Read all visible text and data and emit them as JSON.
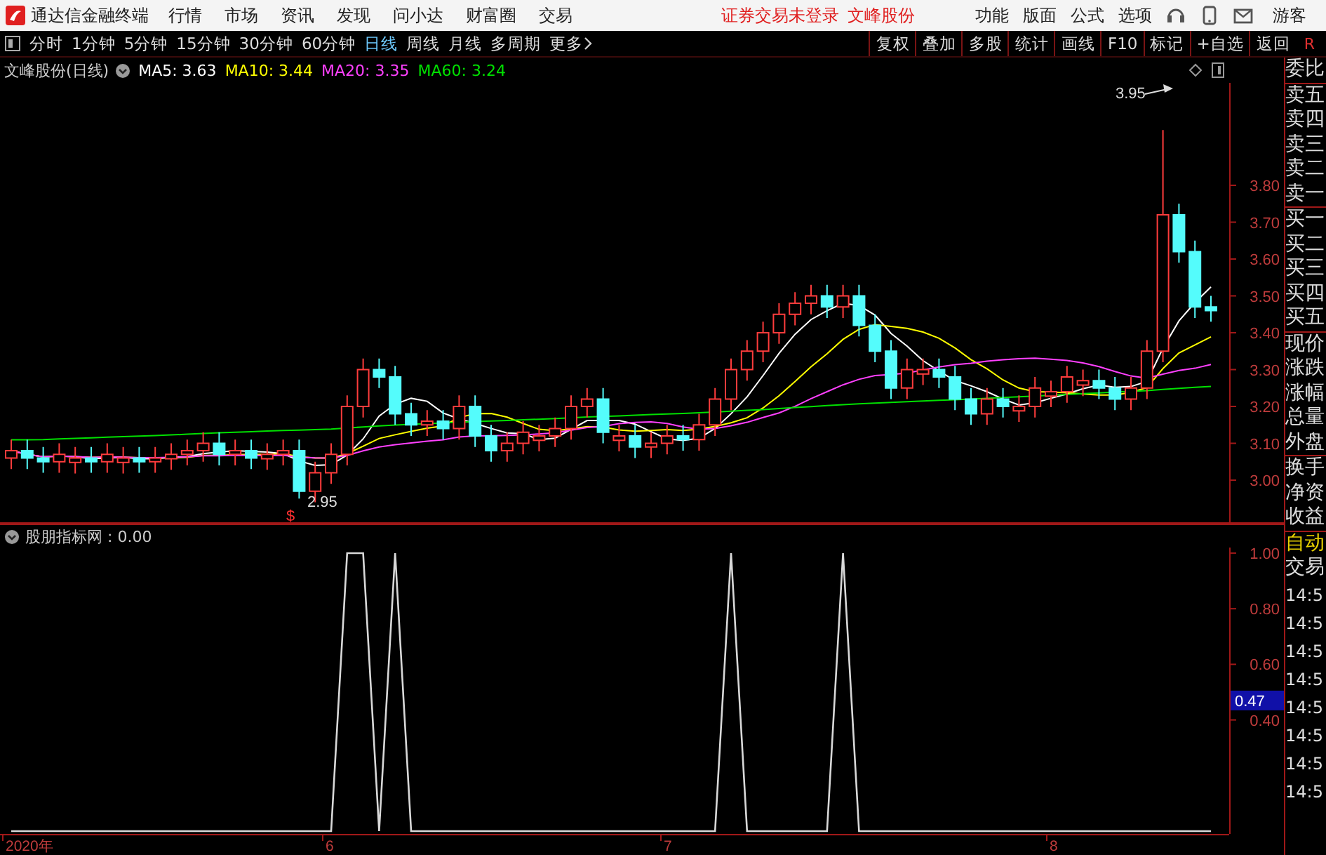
{
  "title_bar": {
    "app_name": "通达信金融终端",
    "menus": [
      "行情",
      "市场",
      "资讯",
      "发现",
      "问小达",
      "财富圈",
      "交易"
    ],
    "login_status": "证券交易未登录",
    "stock_name": "文峰股份",
    "right_menus": [
      "功能",
      "版面",
      "公式",
      "选项"
    ],
    "user": "游客"
  },
  "toolbar": {
    "periods": [
      {
        "label": "分时",
        "selected": false
      },
      {
        "label": "1分钟",
        "selected": false
      },
      {
        "label": "5分钟",
        "selected": false
      },
      {
        "label": "15分钟",
        "selected": false
      },
      {
        "label": "30分钟",
        "selected": false
      },
      {
        "label": "60分钟",
        "selected": false
      },
      {
        "label": "日线",
        "selected": true
      },
      {
        "label": "周线",
        "selected": false
      },
      {
        "label": "月线",
        "selected": false
      },
      {
        "label": "多周期",
        "selected": false
      },
      {
        "label": "更多",
        "selected": false
      }
    ],
    "buttons": [
      "复权",
      "叠加",
      "多股",
      "统计",
      "画线",
      "F10",
      "标记",
      "+自选",
      "返回"
    ],
    "corner": "R"
  },
  "main_chart": {
    "title": "文峰股份(日线)",
    "moving_averages": [
      {
        "label": "MA5: 3.63",
        "color": "#ffffff"
      },
      {
        "label": "MA10: 3.44",
        "color": "#ffff00"
      },
      {
        "label": "MA20: 3.35",
        "color": "#ff40ff"
      },
      {
        "label": "MA60: 3.24",
        "color": "#00e000"
      }
    ],
    "price_ticks": [
      "3.80",
      "3.70",
      "3.60",
      "3.50",
      "3.40",
      "3.30",
      "3.20",
      "3.10",
      "3.00"
    ],
    "high_label": "3.95",
    "low_label": "2.95",
    "signal_mark": "$"
  },
  "indicator": {
    "title": "股朋指标网 : 0.00",
    "cursor_value": "0.47",
    "chart_data": {
      "type": "line",
      "ylim": [
        -0.01,
        1.02
      ],
      "yticks": [
        {
          "value": 0.4,
          "label": "0.40"
        },
        {
          "value": 0.6,
          "label": "0.60"
        },
        {
          "value": 0.8,
          "label": "0.80"
        },
        {
          "value": 1,
          "label": "1.00"
        }
      ],
      "series": [
        {
          "color": "#d8d8d8",
          "values": [
            0,
            0,
            0,
            0,
            0,
            0,
            0,
            0,
            0,
            0,
            0,
            0,
            0,
            0,
            0,
            0,
            0,
            0,
            0,
            0,
            0,
            1,
            1,
            0,
            1,
            0,
            0,
            0,
            0,
            0,
            0,
            0,
            0,
            0,
            0,
            0,
            0,
            0,
            0,
            0,
            0,
            0,
            0,
            0,
            0,
            1,
            0,
            0,
            0,
            0,
            0,
            0,
            1,
            0,
            0,
            0,
            0,
            0,
            0,
            0,
            0,
            0,
            0,
            0,
            0,
            0,
            0,
            0,
            0,
            0,
            0,
            0,
            0,
            0,
            0,
            0
          ]
        }
      ]
    }
  },
  "quote_panel": {
    "groups": [
      [
        "委比"
      ],
      [
        "卖五",
        "卖四",
        "卖三",
        "卖二",
        "卖一"
      ],
      [
        "买一",
        "买二",
        "买三",
        "买四",
        "买五"
      ],
      [
        "现价",
        "涨跌",
        "涨幅",
        "总量",
        "外盘"
      ],
      [
        "换手",
        "净资",
        "收益"
      ]
    ],
    "mode": "自动",
    "trades_label": "交易",
    "times": [
      "14:5",
      "14:5",
      "14:5",
      "14:5",
      "14:5",
      "14:5",
      "14:5",
      "14:5"
    ]
  },
  "date_axis": [
    "2020年",
    "6",
    "7",
    "8"
  ]
}
